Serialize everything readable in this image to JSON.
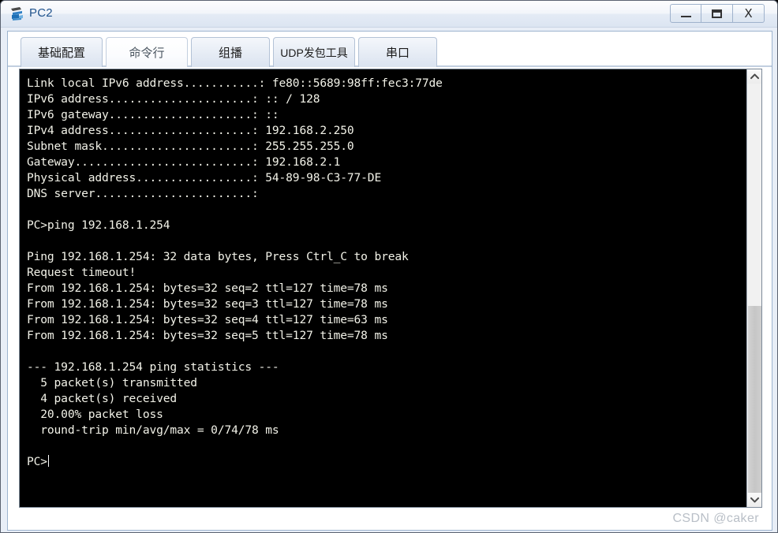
{
  "window": {
    "title": "PC2",
    "icon": "pc-device-icon",
    "controls": {
      "minimize_label": "Minimize",
      "maximize_label": "Maximize",
      "close_label": "X"
    }
  },
  "tabs": [
    {
      "label": "基础配置",
      "name": "tab-basic-config",
      "active": false
    },
    {
      "label": "命令行",
      "name": "tab-command-line",
      "active": true
    },
    {
      "label": "组播",
      "name": "tab-multicast",
      "active": false
    },
    {
      "label": "UDP发包工具",
      "name": "tab-udp-tool",
      "active": false
    },
    {
      "label": "串口",
      "name": "tab-serial-port",
      "active": false
    }
  ],
  "terminal": {
    "prompt": "PC>",
    "foreground_color": "#f2f2e8",
    "background_color": "#000000",
    "lines": [
      "Link local IPv6 address...........: fe80::5689:98ff:fec3:77de",
      "IPv6 address.....................: :: / 128",
      "IPv6 gateway.....................: ::",
      "IPv4 address.....................: 192.168.2.250",
      "Subnet mask......................: 255.255.255.0",
      "Gateway..........................: 192.168.2.1",
      "Physical address.................: 54-89-98-C3-77-DE",
      "DNS server.......................:",
      "",
      "PC>ping 192.168.1.254",
      "",
      "Ping 192.168.1.254: 32 data bytes, Press Ctrl_C to break",
      "Request timeout!",
      "From 192.168.1.254: bytes=32 seq=2 ttl=127 time=78 ms",
      "From 192.168.1.254: bytes=32 seq=3 ttl=127 time=78 ms",
      "From 192.168.1.254: bytes=32 seq=4 ttl=127 time=63 ms",
      "From 192.168.1.254: bytes=32 seq=5 ttl=127 time=78 ms",
      "",
      "--- 192.168.1.254 ping statistics ---",
      "  5 packet(s) transmitted",
      "  4 packet(s) received",
      "  20.00% packet loss",
      "  round-trip min/avg/max = 0/74/78 ms",
      "",
      "PC>"
    ],
    "ping_summary": {
      "target": "192.168.1.254",
      "data_bytes": 32,
      "transmitted": 5,
      "received": 4,
      "packet_loss": "20.00%",
      "rtt_min": 0,
      "rtt_avg": 74,
      "rtt_max": 78,
      "rtt_unit": "ms"
    },
    "interface": {
      "link_local_ipv6": "fe80::5689:98ff:fec3:77de",
      "ipv6_address": ":: / 128",
      "ipv6_gateway": "::",
      "ipv4_address": "192.168.2.250",
      "subnet_mask": "255.255.255.0",
      "gateway": "192.168.2.1",
      "physical_address": "54-89-98-C3-77-DE",
      "dns_server": ""
    }
  },
  "scrollbar": {
    "up_arrow": "chevron-up-icon",
    "down_arrow": "chevron-down-icon"
  },
  "watermark": {
    "text": "CSDN @caker"
  }
}
